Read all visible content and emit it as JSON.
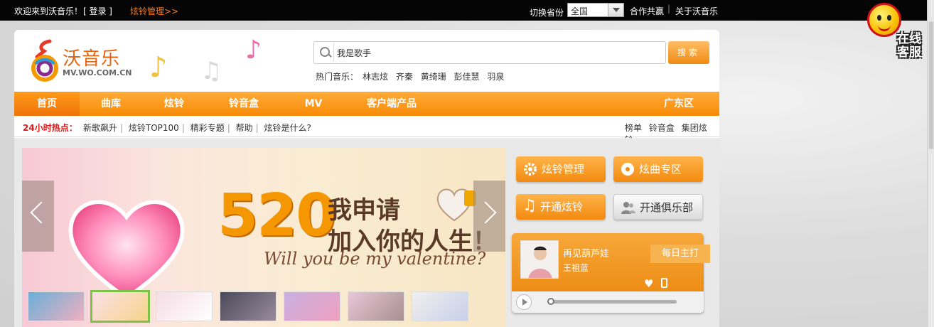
{
  "topbar": {
    "welcome": "欢迎来到沃音乐！",
    "login": "[ 登录 ]",
    "ringtone_mgmt": "炫铃管理>>",
    "province_label": "切换省份",
    "province_value": "全国",
    "cooperate": "合作共赢",
    "separator": "|",
    "about": "关于沃音乐"
  },
  "service": {
    "label_line1": "在线",
    "label_line2": "客服"
  },
  "logo": {
    "name": "沃音乐",
    "url": "MV.WO.COM.CN"
  },
  "search": {
    "value": "我是歌手",
    "button": "搜索",
    "hot_label": "热门音乐：",
    "hot_items": [
      "林志炫",
      "齐秦",
      "黄绮珊",
      "彭佳慧",
      "羽泉"
    ]
  },
  "nav": {
    "items": [
      "首页",
      "曲库",
      "炫铃",
      "铃音盒",
      "MV",
      "客户端产品"
    ],
    "region": "广东区"
  },
  "hotrow": {
    "label": "24小时热点：",
    "links": [
      "新歌飙升",
      "炫铃TOP100",
      "精彩专题",
      "帮助",
      "炫铃是什么?"
    ],
    "right_links": [
      "榜单",
      "铃音盒",
      "集团炫铃"
    ]
  },
  "banner": {
    "number": "520",
    "line1": "我申请",
    "line2": "加入你的人生！",
    "script": "Will you be my valentine?"
  },
  "quick": {
    "rbt_mgmt": "炫铃管理",
    "song_zone": "炫曲专区",
    "open_rbt": "开通炫铃",
    "open_club": "开通俱乐部"
  },
  "player": {
    "title": "再见葫芦娃",
    "artist": "王祖蓝",
    "daily": "每日主打",
    "progress": 0.0
  },
  "colors": {
    "accent": "#f98b06",
    "hot_red": "#e01a1a",
    "topbar": "#050505",
    "thumb_active": "#7dc24a"
  }
}
